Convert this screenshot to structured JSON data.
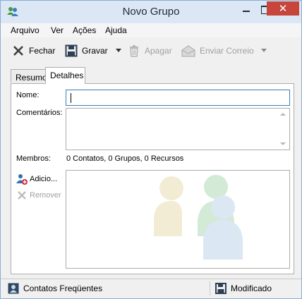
{
  "window": {
    "title": "Novo Grupo"
  },
  "menu": [
    "Arquivo",
    "Ver",
    "Ações",
    "Ajuda"
  ],
  "toolbar": {
    "close_label": "Fechar",
    "save_label": "Gravar",
    "delete_label": "Apagar",
    "send_label": "Enviar Correio"
  },
  "tabs": [
    {
      "label": "Resumo",
      "active": false
    },
    {
      "label": "Detalhes",
      "active": true
    }
  ],
  "form": {
    "name_label": "Nome:",
    "name_value": "",
    "comments_label": "Comentários:",
    "comments_value": "",
    "members_label": "Membros:",
    "members_summary": "0 Contatos, 0 Grupos, 0 Recursos",
    "add_label": "Adicio...",
    "remove_label": "Remover"
  },
  "status": {
    "left_label": "Contatos Freqüentes",
    "right_label": "Modificado"
  },
  "colors": {
    "accent": "#3c7fb1",
    "close_button": "#c7453a",
    "titlebar": "#dbe7f4"
  }
}
